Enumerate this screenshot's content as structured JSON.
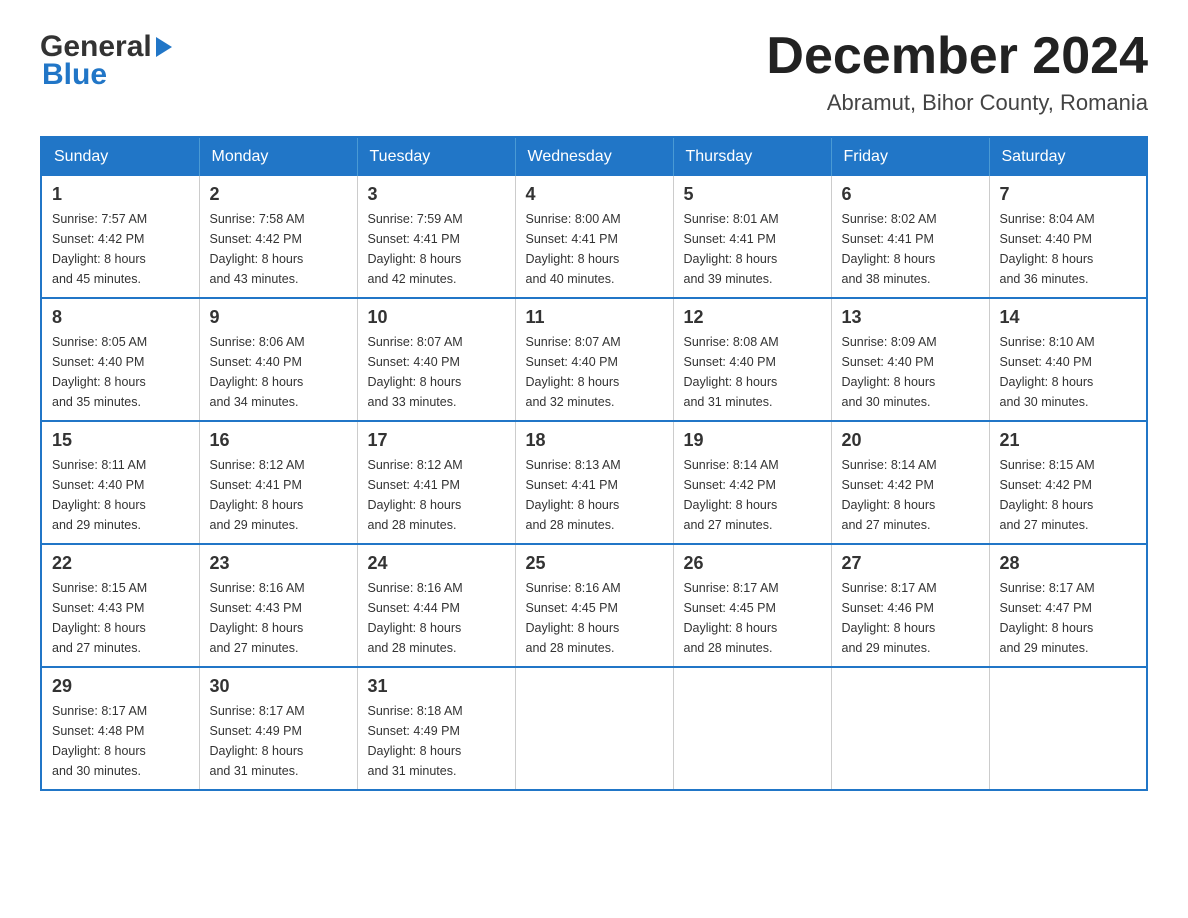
{
  "header": {
    "logo_line1": "General",
    "logo_line2": "Blue",
    "month_title": "December 2024",
    "location": "Abramut, Bihor County, Romania"
  },
  "columns": [
    "Sunday",
    "Monday",
    "Tuesday",
    "Wednesday",
    "Thursday",
    "Friday",
    "Saturday"
  ],
  "weeks": [
    [
      {
        "day": "1",
        "sunrise": "Sunrise: 7:57 AM",
        "sunset": "Sunset: 4:42 PM",
        "daylight": "Daylight: 8 hours",
        "minutes": "and 45 minutes."
      },
      {
        "day": "2",
        "sunrise": "Sunrise: 7:58 AM",
        "sunset": "Sunset: 4:42 PM",
        "daylight": "Daylight: 8 hours",
        "minutes": "and 43 minutes."
      },
      {
        "day": "3",
        "sunrise": "Sunrise: 7:59 AM",
        "sunset": "Sunset: 4:41 PM",
        "daylight": "Daylight: 8 hours",
        "minutes": "and 42 minutes."
      },
      {
        "day": "4",
        "sunrise": "Sunrise: 8:00 AM",
        "sunset": "Sunset: 4:41 PM",
        "daylight": "Daylight: 8 hours",
        "minutes": "and 40 minutes."
      },
      {
        "day": "5",
        "sunrise": "Sunrise: 8:01 AM",
        "sunset": "Sunset: 4:41 PM",
        "daylight": "Daylight: 8 hours",
        "minutes": "and 39 minutes."
      },
      {
        "day": "6",
        "sunrise": "Sunrise: 8:02 AM",
        "sunset": "Sunset: 4:41 PM",
        "daylight": "Daylight: 8 hours",
        "minutes": "and 38 minutes."
      },
      {
        "day": "7",
        "sunrise": "Sunrise: 8:04 AM",
        "sunset": "Sunset: 4:40 PM",
        "daylight": "Daylight: 8 hours",
        "minutes": "and 36 minutes."
      }
    ],
    [
      {
        "day": "8",
        "sunrise": "Sunrise: 8:05 AM",
        "sunset": "Sunset: 4:40 PM",
        "daylight": "Daylight: 8 hours",
        "minutes": "and 35 minutes."
      },
      {
        "day": "9",
        "sunrise": "Sunrise: 8:06 AM",
        "sunset": "Sunset: 4:40 PM",
        "daylight": "Daylight: 8 hours",
        "minutes": "and 34 minutes."
      },
      {
        "day": "10",
        "sunrise": "Sunrise: 8:07 AM",
        "sunset": "Sunset: 4:40 PM",
        "daylight": "Daylight: 8 hours",
        "minutes": "and 33 minutes."
      },
      {
        "day": "11",
        "sunrise": "Sunrise: 8:07 AM",
        "sunset": "Sunset: 4:40 PM",
        "daylight": "Daylight: 8 hours",
        "minutes": "and 32 minutes."
      },
      {
        "day": "12",
        "sunrise": "Sunrise: 8:08 AM",
        "sunset": "Sunset: 4:40 PM",
        "daylight": "Daylight: 8 hours",
        "minutes": "and 31 minutes."
      },
      {
        "day": "13",
        "sunrise": "Sunrise: 8:09 AM",
        "sunset": "Sunset: 4:40 PM",
        "daylight": "Daylight: 8 hours",
        "minutes": "and 30 minutes."
      },
      {
        "day": "14",
        "sunrise": "Sunrise: 8:10 AM",
        "sunset": "Sunset: 4:40 PM",
        "daylight": "Daylight: 8 hours",
        "minutes": "and 30 minutes."
      }
    ],
    [
      {
        "day": "15",
        "sunrise": "Sunrise: 8:11 AM",
        "sunset": "Sunset: 4:40 PM",
        "daylight": "Daylight: 8 hours",
        "minutes": "and 29 minutes."
      },
      {
        "day": "16",
        "sunrise": "Sunrise: 8:12 AM",
        "sunset": "Sunset: 4:41 PM",
        "daylight": "Daylight: 8 hours",
        "minutes": "and 29 minutes."
      },
      {
        "day": "17",
        "sunrise": "Sunrise: 8:12 AM",
        "sunset": "Sunset: 4:41 PM",
        "daylight": "Daylight: 8 hours",
        "minutes": "and 28 minutes."
      },
      {
        "day": "18",
        "sunrise": "Sunrise: 8:13 AM",
        "sunset": "Sunset: 4:41 PM",
        "daylight": "Daylight: 8 hours",
        "minutes": "and 28 minutes."
      },
      {
        "day": "19",
        "sunrise": "Sunrise: 8:14 AM",
        "sunset": "Sunset: 4:42 PM",
        "daylight": "Daylight: 8 hours",
        "minutes": "and 27 minutes."
      },
      {
        "day": "20",
        "sunrise": "Sunrise: 8:14 AM",
        "sunset": "Sunset: 4:42 PM",
        "daylight": "Daylight: 8 hours",
        "minutes": "and 27 minutes."
      },
      {
        "day": "21",
        "sunrise": "Sunrise: 8:15 AM",
        "sunset": "Sunset: 4:42 PM",
        "daylight": "Daylight: 8 hours",
        "minutes": "and 27 minutes."
      }
    ],
    [
      {
        "day": "22",
        "sunrise": "Sunrise: 8:15 AM",
        "sunset": "Sunset: 4:43 PM",
        "daylight": "Daylight: 8 hours",
        "minutes": "and 27 minutes."
      },
      {
        "day": "23",
        "sunrise": "Sunrise: 8:16 AM",
        "sunset": "Sunset: 4:43 PM",
        "daylight": "Daylight: 8 hours",
        "minutes": "and 27 minutes."
      },
      {
        "day": "24",
        "sunrise": "Sunrise: 8:16 AM",
        "sunset": "Sunset: 4:44 PM",
        "daylight": "Daylight: 8 hours",
        "minutes": "and 28 minutes."
      },
      {
        "day": "25",
        "sunrise": "Sunrise: 8:16 AM",
        "sunset": "Sunset: 4:45 PM",
        "daylight": "Daylight: 8 hours",
        "minutes": "and 28 minutes."
      },
      {
        "day": "26",
        "sunrise": "Sunrise: 8:17 AM",
        "sunset": "Sunset: 4:45 PM",
        "daylight": "Daylight: 8 hours",
        "minutes": "and 28 minutes."
      },
      {
        "day": "27",
        "sunrise": "Sunrise: 8:17 AM",
        "sunset": "Sunset: 4:46 PM",
        "daylight": "Daylight: 8 hours",
        "minutes": "and 29 minutes."
      },
      {
        "day": "28",
        "sunrise": "Sunrise: 8:17 AM",
        "sunset": "Sunset: 4:47 PM",
        "daylight": "Daylight: 8 hours",
        "minutes": "and 29 minutes."
      }
    ],
    [
      {
        "day": "29",
        "sunrise": "Sunrise: 8:17 AM",
        "sunset": "Sunset: 4:48 PM",
        "daylight": "Daylight: 8 hours",
        "minutes": "and 30 minutes."
      },
      {
        "day": "30",
        "sunrise": "Sunrise: 8:17 AM",
        "sunset": "Sunset: 4:49 PM",
        "daylight": "Daylight: 8 hours",
        "minutes": "and 31 minutes."
      },
      {
        "day": "31",
        "sunrise": "Sunrise: 8:18 AM",
        "sunset": "Sunset: 4:49 PM",
        "daylight": "Daylight: 8 hours",
        "minutes": "and 31 minutes."
      },
      null,
      null,
      null,
      null
    ]
  ]
}
